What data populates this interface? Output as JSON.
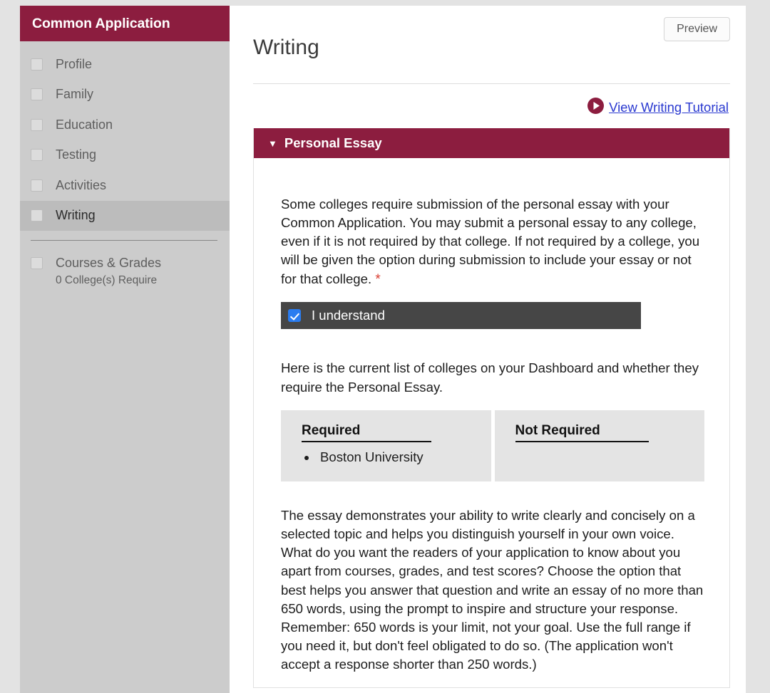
{
  "theme": {
    "brand_maroon": "#8c1d3f",
    "link_blue": "#2a39d0",
    "required_red": "#d83a2e",
    "checkbox_blue": "#2a7cf0",
    "sidebar_gray": "#cccccc",
    "sidebar_active_gray": "#bcbcbc",
    "dark_bar_gray": "#464646",
    "table_cell_gray": "#e4e4e4"
  },
  "sidebar": {
    "title": "Common Application",
    "items": [
      {
        "label": "Profile",
        "active": false
      },
      {
        "label": "Family",
        "active": false
      },
      {
        "label": "Education",
        "active": false
      },
      {
        "label": "Testing",
        "active": false
      },
      {
        "label": "Activities",
        "active": false
      },
      {
        "label": "Writing",
        "active": true
      }
    ],
    "footer_item": {
      "label": "Courses & Grades",
      "sublabel": "0 College(s) Require"
    }
  },
  "header": {
    "title": "Writing",
    "preview_label": "Preview"
  },
  "tutorial": {
    "icon": "play-circle-icon",
    "link_label": "View Writing Tutorial"
  },
  "panel": {
    "caret": "▼",
    "title": "Personal Essay",
    "intro_paragraph": "Some colleges require submission of the personal essay with your Common Application. You may submit a personal essay to any college, even if it is not required by that college. If not required by a college, you will be given the option during submission to include your essay or not for that college.",
    "required_marker": "*",
    "understand_label": "I understand",
    "understand_checked": true,
    "list_intro_paragraph": "Here is the current list of colleges on your Dashboard and whether they require the Personal Essay.",
    "college_table": {
      "columns": [
        {
          "header": "Required",
          "colleges": [
            "Boston University"
          ]
        },
        {
          "header": "Not Required",
          "colleges": []
        }
      ]
    },
    "essay_description": "The essay demonstrates your ability to write clearly and concisely on a selected topic and helps you distinguish yourself in your own voice. What do you want the readers of your application to know about you apart from courses, grades, and test scores? Choose the option that best helps you answer that question and write an essay of no more than 650 words, using the prompt to inspire and structure your response. Remember: 650 words is your limit, not your goal. Use the full range if you need it, but don't feel obligated to do so. (The application won't accept a response shorter than 250 words.)"
  }
}
